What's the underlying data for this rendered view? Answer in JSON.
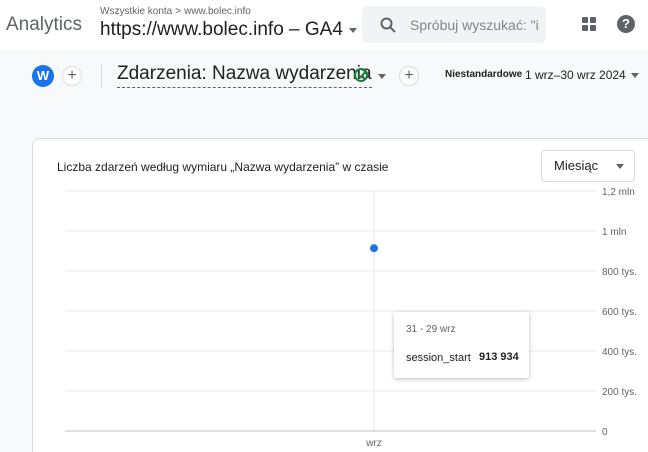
{
  "header": {
    "app_name": "Analytics",
    "breadcrumb_root": "Wszystkie konta",
    "breadcrumb_sep": ">",
    "breadcrumb_account": "www.bolec.info",
    "property_name": "https://www.bolec.info – GA4",
    "search_placeholder": "Spróbuj wyszukać: \"i..."
  },
  "report": {
    "avatar_letter": "W",
    "add_label": "+",
    "title": "Zdarzenia: Nazwa wydarzenia",
    "date_label": "Niestandardowe",
    "date_range": "1 wrz–30 wrz 2024"
  },
  "card": {
    "title": "Liczba zdarzeń według wymiaru „Nazwa wydarzenia” w czasie",
    "granularity": "Miesiąc"
  },
  "chart_data": {
    "type": "line",
    "title": "Liczba zdarzeń według wymiaru „Nazwa wydarzenia” w czasie",
    "x": [
      "wrz"
    ],
    "series": [
      {
        "name": "session_start",
        "values": [
          913934
        ]
      }
    ],
    "ylim": [
      0,
      1200000
    ],
    "y_ticks": [
      0,
      200000,
      400000,
      600000,
      800000,
      1000000,
      1200000
    ],
    "y_tick_labels": [
      "0",
      "200 tys.",
      "400 tys.",
      "600 tys.",
      "800 tys.",
      "1 mln",
      "1,2 mln"
    ],
    "grid": true,
    "colors": {
      "series": "#1a73e8"
    }
  },
  "tooltip": {
    "date": "31 - 29 wrz",
    "metric_name": "session_start",
    "metric_value": "913 934"
  }
}
